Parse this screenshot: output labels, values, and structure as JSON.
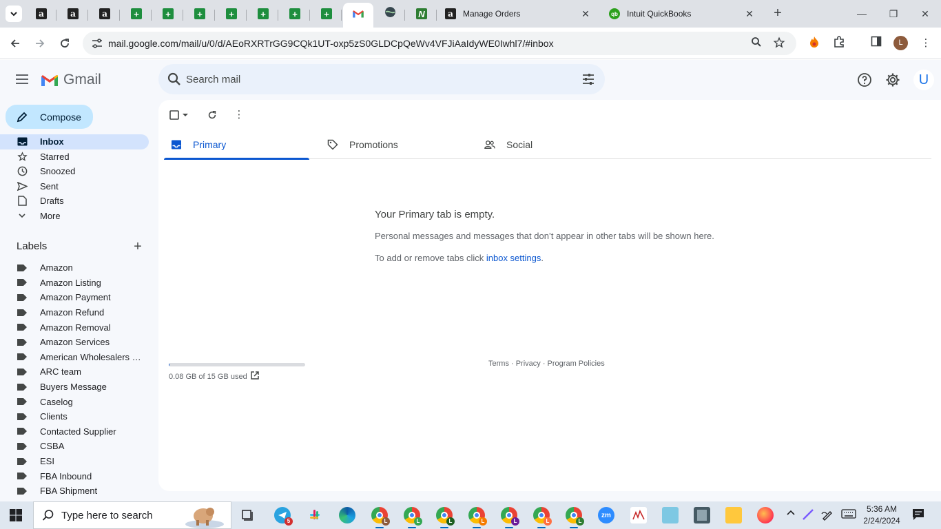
{
  "browser": {
    "pinned_tabs": [
      {
        "icon": "amazon-icon",
        "glyph": "a"
      },
      {
        "icon": "amazon-icon",
        "glyph": "a"
      },
      {
        "icon": "amazon-icon",
        "glyph": "a"
      },
      {
        "icon": "sheets-icon",
        "glyph": "+"
      },
      {
        "icon": "sheets-icon",
        "glyph": "+"
      },
      {
        "icon": "sheets-icon",
        "glyph": "+"
      },
      {
        "icon": "sheets-icon",
        "glyph": "+"
      },
      {
        "icon": "sheets-icon",
        "glyph": "+"
      },
      {
        "icon": "sheets-icon",
        "glyph": "+"
      },
      {
        "icon": "sheets-icon",
        "glyph": "+"
      },
      {
        "icon": "gmail-icon",
        "glyph": "M"
      },
      {
        "icon": "globe-icon",
        "glyph": ""
      },
      {
        "icon": "n-app-icon",
        "glyph": "N"
      }
    ],
    "tabs": [
      {
        "title": "Manage Orders",
        "icon": "amazon-icon"
      },
      {
        "title": "Intuit QuickBooks",
        "icon": "quickbooks-icon"
      }
    ],
    "url": "mail.google.com/mail/u/0/d/AEoRXRTrGG9CQk1UT-oxp5zS0GLDCpQeWv4VFJiAaIdyWE0Iwhl7/#inbox",
    "profile_initial": "L"
  },
  "gmail": {
    "logo_text": "Gmail",
    "search_placeholder": "Search mail",
    "account_initial": "U",
    "compose_label": "Compose",
    "nav": [
      {
        "label": "Inbox",
        "icon": "inbox-icon",
        "active": true
      },
      {
        "label": "Starred",
        "icon": "star-icon"
      },
      {
        "label": "Snoozed",
        "icon": "clock-icon"
      },
      {
        "label": "Sent",
        "icon": "send-icon"
      },
      {
        "label": "Drafts",
        "icon": "draft-icon"
      },
      {
        "label": "More",
        "icon": "chevron-down-icon"
      }
    ],
    "labels_heading": "Labels",
    "labels": [
      "Amazon",
      "Amazon Listing",
      "Amazon Payment",
      "Amazon Refund",
      "Amazon Removal",
      "Amazon Services",
      "American Wholesalers L...",
      "ARC team",
      "Buyers Message",
      "Caselog",
      "Clients",
      "Contacted Supplier",
      "CSBA",
      "ESI",
      "FBA Inbound",
      "FBA Shipment"
    ],
    "category_tabs": [
      {
        "label": "Primary",
        "icon": "inbox-icon",
        "active": true
      },
      {
        "label": "Promotions",
        "icon": "tag-icon"
      },
      {
        "label": "Social",
        "icon": "people-icon"
      }
    ],
    "empty": {
      "title": "Your Primary tab is empty.",
      "description": "Personal messages and messages that don’t appear in other tabs will be shown here.",
      "note_prefix": "To add or remove tabs click ",
      "note_link": "inbox settings",
      "note_suffix": "."
    },
    "storage": {
      "text": "0.08 GB of 15 GB used",
      "used_fraction": 0.0053
    },
    "footer": "Terms · Privacy · Program Policies"
  },
  "taskbar": {
    "search_placeholder": "Type here to search",
    "time": "5:36 AM",
    "date": "2/24/2024",
    "telegram_badge": "5",
    "chrome_profiles": [
      "L",
      "L",
      "L",
      "L",
      "L",
      "L",
      "L"
    ]
  },
  "colors": {
    "accent_blue": "#0b57d0",
    "compose_bg": "#c2e7ff",
    "nav_active_bg": "#d3e3fd",
    "gmail_red": "#ea4335"
  }
}
